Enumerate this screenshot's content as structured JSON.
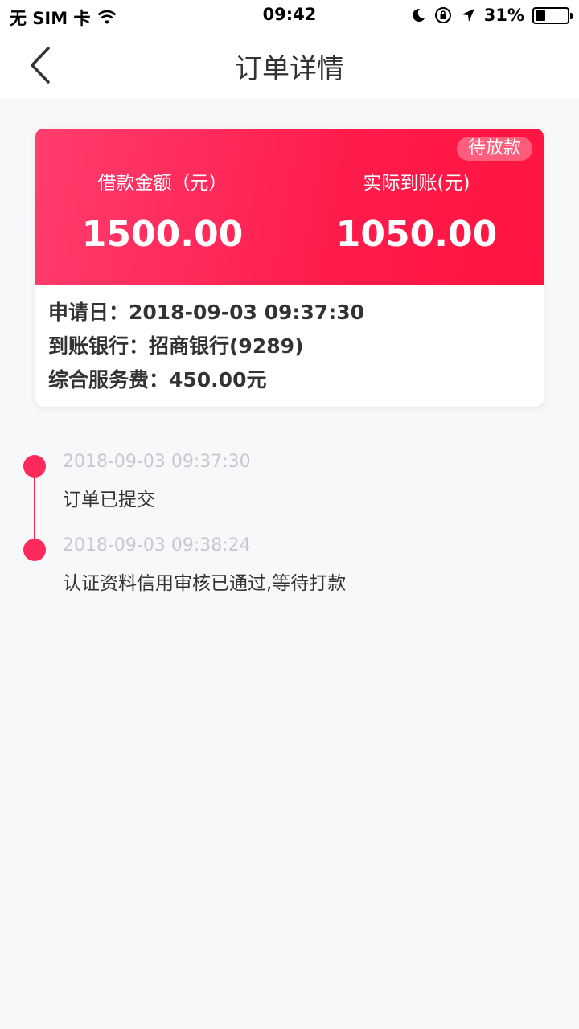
{
  "status_bar": {
    "carrier": "无 SIM 卡",
    "time": "09:42",
    "battery_percent": "31%",
    "battery_level": 0.31
  },
  "nav": {
    "title": "订单详情"
  },
  "order_card": {
    "status_badge": "待放款",
    "loan_amount_label": "借款金额（元）",
    "loan_amount_value": "1500.00",
    "actual_label": "实际到账(元)",
    "actual_value": "1050.00",
    "info": [
      "申请日：2018-09-03 09:37:30",
      "到账银行：招商银行(9289)",
      "综合服务费：450.00元"
    ]
  },
  "timeline": [
    {
      "time": "2018-09-03 09:37:30",
      "text": "订单已提交"
    },
    {
      "time": "2018-09-03 09:38:24",
      "text": "认证资料信用审核已通过,等待打款"
    }
  ],
  "colors": {
    "accent": "#ff2a5a",
    "background": "#f7f8fa"
  }
}
